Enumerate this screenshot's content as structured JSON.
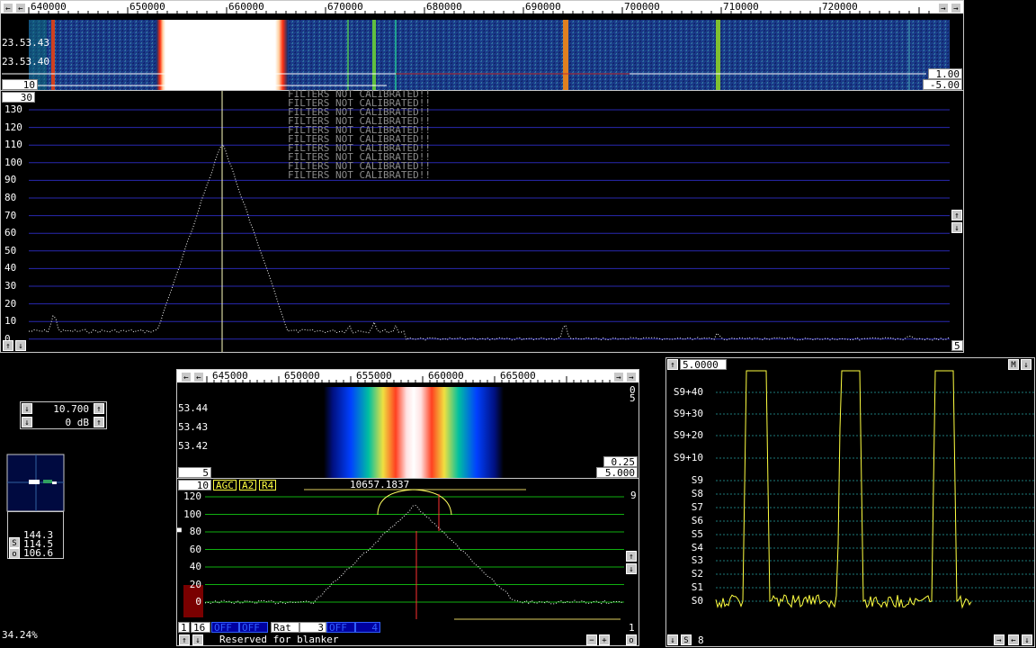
{
  "top": {
    "freq_ticks": [
      "640000",
      "650000",
      "660000",
      "670000",
      "680000",
      "690000",
      "700000",
      "710000",
      "720000"
    ],
    "time_labels": [
      "23.53.43",
      "23.53.40"
    ],
    "wf_avg": "10",
    "wf_gain": "1.00",
    "wf_zero": "-5.00",
    "spec_avg": "30",
    "spec_y_labels": [
      "130",
      "120",
      "110",
      "100",
      "90",
      "80",
      "70",
      "60",
      "50",
      "40",
      "30",
      "20",
      "10",
      "0"
    ],
    "spec_right_value": "5",
    "warning": "FILTERS NOT CALIBRATED!!"
  },
  "control": {
    "bandwidth": "10.700",
    "attenuation": "0 dB"
  },
  "meter": {
    "values": [
      "144.3",
      "114.5",
      "106.6"
    ],
    "s_label": "S",
    "o_label": "o"
  },
  "status": {
    "cpu": "34.24%"
  },
  "baseband": {
    "freq_ticks": [
      "645000",
      "650000",
      "655000",
      "660000",
      "665000"
    ],
    "time_labels": [
      "53.44",
      "53.43",
      "53.42"
    ],
    "right_top": [
      "0",
      "5"
    ],
    "wf_avg": "5",
    "wf_gain": "0.25",
    "wf_zero": "5.000",
    "spec_avg": "10",
    "agc": "AGC",
    "a2": "A2",
    "r4": "R4",
    "freq_readout": "10657.1837",
    "y_labels": [
      "120",
      "100",
      "80",
      "60",
      "40",
      "20",
      "0"
    ],
    "right_9": "9",
    "right_1": "1",
    "bottom_16": "16",
    "bottom_1": "1",
    "bottom_off1": "OFF",
    "bottom_off2": "OFF",
    "rat_label": "Rat",
    "rat_value": "3",
    "bottom_off3": "OFF",
    "off3_val": "4",
    "blanker": "Reserved for blanker",
    "o_btn": "o"
  },
  "smeter": {
    "top_value": "5.0000",
    "m_label": "M",
    "labels": [
      "S9+40",
      "S9+30",
      "S9+20",
      "S9+10",
      "S9",
      "S8",
      "S7",
      "S6",
      "S5",
      "S4",
      "S3",
      "S2",
      "S1",
      "S0"
    ],
    "bottom_s": "S",
    "bottom_value": "8"
  }
}
